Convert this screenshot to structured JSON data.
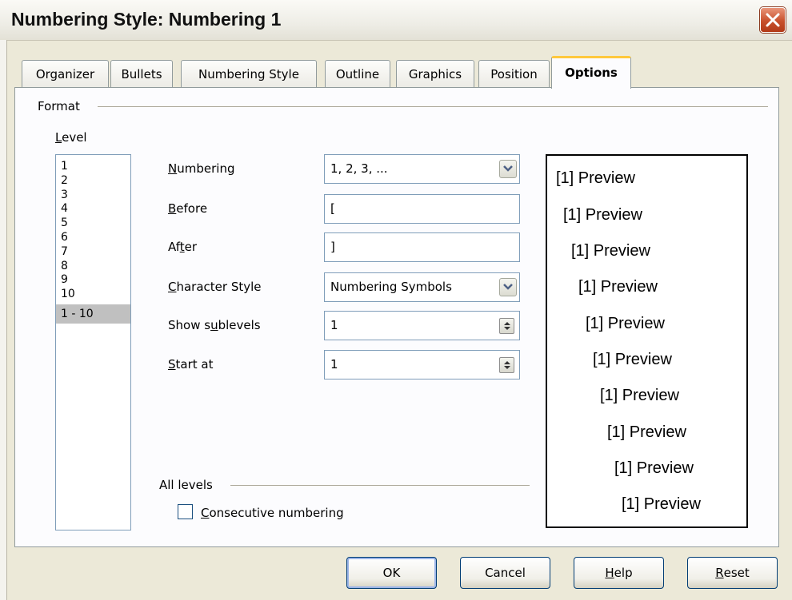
{
  "window": {
    "title": "Numbering Style: Numbering 1"
  },
  "tabs": [
    {
      "label": "Organizer"
    },
    {
      "label": "Bullets"
    },
    {
      "label": "Numbering Style"
    },
    {
      "label": "Outline"
    },
    {
      "label": "Graphics"
    },
    {
      "label": "Position"
    },
    {
      "label": "Options",
      "active": true
    }
  ],
  "format": {
    "section_label": "Format",
    "level_label": "Level",
    "levels": [
      "1",
      "2",
      "3",
      "4",
      "5",
      "6",
      "7",
      "8",
      "9",
      "10",
      "1 - 10"
    ],
    "selected_level": "1 - 10"
  },
  "fields": {
    "numbering": {
      "label": "Numbering",
      "value": "1, 2, 3, ..."
    },
    "before": {
      "label": "Before",
      "value": "["
    },
    "after": {
      "label": "After",
      "value": "]"
    },
    "character_style": {
      "label": "Character Style",
      "value": "Numbering Symbols"
    },
    "show_sublevels": {
      "label": "Show sublevels",
      "value": "1"
    },
    "start_at": {
      "label": "Start at",
      "value": "1"
    }
  },
  "preview": {
    "lines": [
      "[1] Preview",
      "[1] Preview",
      "[1] Preview",
      "[1] Preview",
      "[1] Preview",
      "[1] Preview",
      "[1] Preview",
      "[1] Preview",
      "[1] Preview",
      "[1] Preview"
    ]
  },
  "all_levels": {
    "section_label": "All levels",
    "consecutive_numbering": {
      "label": "Consecutive numbering",
      "checked": false
    }
  },
  "buttons": {
    "ok": "OK",
    "cancel": "Cancel",
    "help": "Help",
    "reset": "Reset"
  },
  "icons": {
    "close": "close-icon",
    "dropdown": "chevron-down-icon",
    "spin": "spin-arrows-icon"
  },
  "colors": {
    "close_button": "#c8502c",
    "active_tab_accent": "#ffc83c",
    "dialog_bg": "#ece9d8"
  }
}
